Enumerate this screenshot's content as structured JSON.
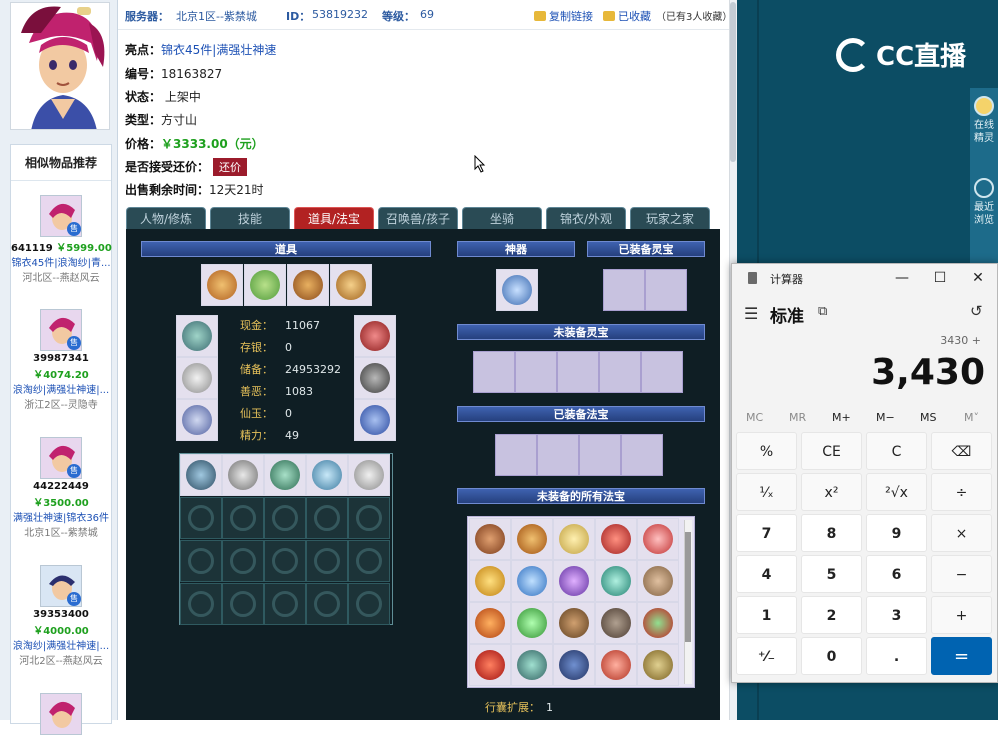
{
  "header": {
    "server_label": "服务器：",
    "server_value": "北京1区--紫禁城",
    "id_label": "ID：",
    "id_value": "53819232",
    "level_label": "等级：",
    "level_value": "69",
    "copy_link": "复制链接",
    "collected": "已收藏",
    "collect_count": "（已有3人收藏）"
  },
  "info": {
    "highlight_label": "亮点：",
    "highlight_value": "锦衣45件|满强壮神速",
    "number_label": "编号：",
    "number_value": "18163827",
    "status_label": "状态：",
    "status_value": "上架中",
    "type_label": "类型：",
    "type_value": "方寸山",
    "price_label": "价格：",
    "price_value": "￥3333.00（元）",
    "counter_label": "是否接受还价：",
    "counter_button": "还价",
    "remaining_label": "出售剩余时间：",
    "remaining_value": "12天21时"
  },
  "recommend": {
    "title": "相似物品推荐",
    "sell_tag": "售",
    "items": [
      {
        "id": "641119",
        "price": "￥5999.00",
        "tags": "锦衣45件|浪淘纱|青...",
        "server": "河北区--燕赵风云"
      },
      {
        "id": "39987341",
        "price": "￥4074.20",
        "tags": "浪淘纱|满强壮神速|...",
        "server": "浙江2区--灵隐寺"
      },
      {
        "id": "44222449",
        "price": "￥3500.00",
        "tags": "满强壮神速|锦衣36件",
        "server": "北京1区--紫禁城"
      },
      {
        "id": "39353400",
        "price": "￥4000.00",
        "tags": "浪淘纱|满强壮神速|...",
        "server": "河北2区--燕赵风云"
      }
    ]
  },
  "tabs": [
    "人物/修炼",
    "技能",
    "道具/法宝",
    "召唤兽/孩子",
    "坐骑",
    "锦衣/外观",
    "玩家之家"
  ],
  "active_tab": "道具/法宝",
  "game": {
    "items_bar": "道具",
    "artifact_bar": "神器",
    "equipped_spirit_bar": "已装备灵宝",
    "unequipped_spirit_bar": "未装备灵宝",
    "equipped_magic_bar": "已装备法宝",
    "all_magic_bar": "未装备的所有法宝",
    "stats": [
      {
        "k": "现金：",
        "v": "11067"
      },
      {
        "k": "存银：",
        "v": "0"
      },
      {
        "k": "储备：",
        "v": "24953292"
      },
      {
        "k": "善恶：",
        "v": "1083"
      },
      {
        "k": "仙玉：",
        "v": "0"
      },
      {
        "k": "精力：",
        "v": "49"
      }
    ],
    "bag_expand_label": "行囊扩展：",
    "bag_expand_value": "1"
  },
  "stream": {
    "logo_text": "CC直播",
    "side_items": [
      "在线精灵",
      "最近浏览"
    ]
  },
  "calculator": {
    "app_title": "计算器",
    "mode": "标准",
    "expression": "3430 +",
    "display": "3,430",
    "memory": [
      "MC",
      "MR",
      "M+",
      "M−",
      "MS",
      "M˅"
    ],
    "keys": [
      [
        "%",
        "CE",
        "C",
        "⌫"
      ],
      [
        "¹⁄ₓ",
        "x²",
        "²√x",
        "÷"
      ],
      [
        "7",
        "8",
        "9",
        "×"
      ],
      [
        "4",
        "5",
        "6",
        "−"
      ],
      [
        "1",
        "2",
        "3",
        "+"
      ],
      [
        "⁺⁄₋",
        "0",
        ".",
        "="
      ]
    ]
  }
}
